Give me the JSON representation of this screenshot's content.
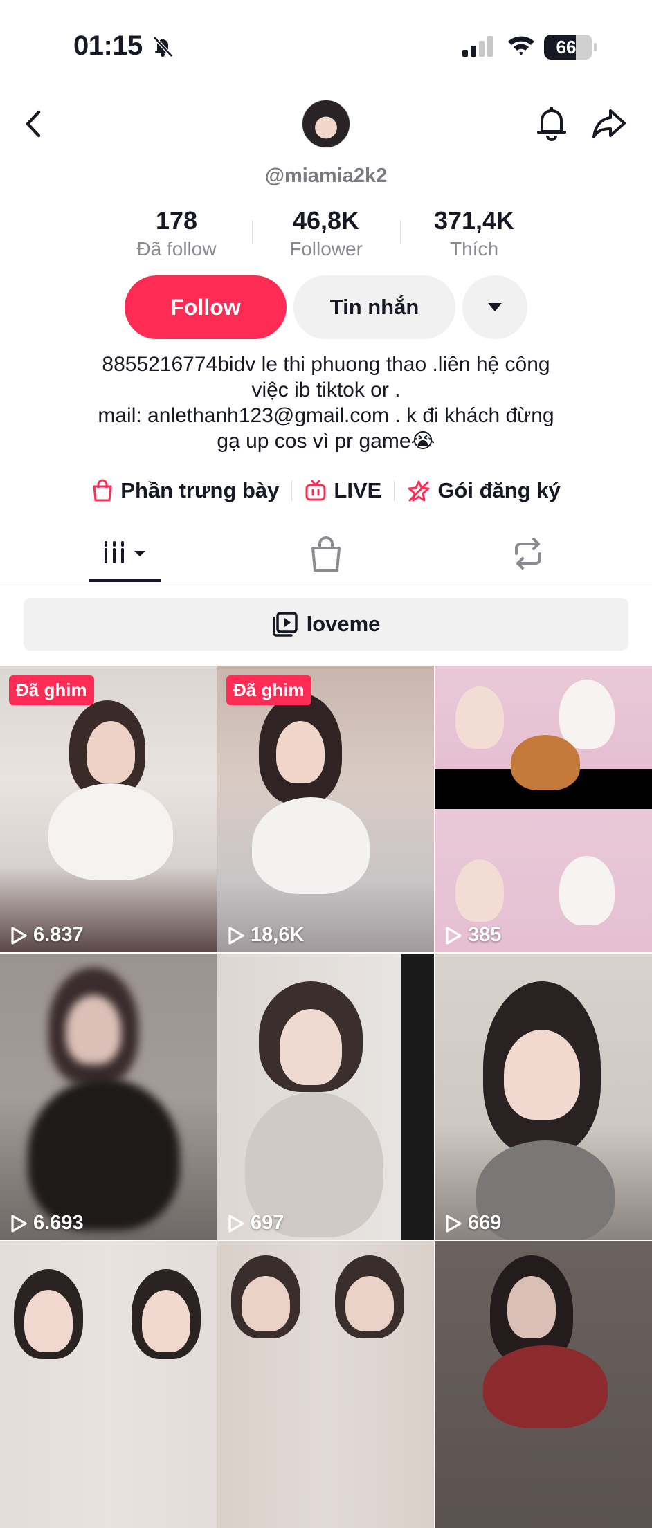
{
  "status_bar": {
    "time": "01:15",
    "battery": "66"
  },
  "profile": {
    "handle": "@miamia2k2",
    "stats": [
      {
        "value": "178",
        "label": "Đã follow"
      },
      {
        "value": "46,8K",
        "label": "Follower"
      },
      {
        "value": "371,4K",
        "label": "Thích"
      }
    ],
    "follow_label": "Follow",
    "message_label": "Tin nhắn",
    "bio": "8855216774bidv le thi phuong thao .liên hệ công\nviệc ib tiktok or .\nmail: anlethanh123@gmail.com  . k đi khách đừng\ngạ up cos vì pr game😭"
  },
  "links": [
    {
      "label": "Phần trưng bày",
      "icon": "shopping-bag-icon"
    },
    {
      "label": "LIVE",
      "icon": "live-tv-icon"
    },
    {
      "label": "Gói đăng ký",
      "icon": "subscription-star-icon"
    }
  ],
  "tabs": [
    "videos-grid-icon",
    "shop-bag-icon",
    "repost-icon"
  ],
  "playlist": {
    "label": "loveme"
  },
  "videos": [
    {
      "views": "6.837",
      "pinned": "Đã ghim"
    },
    {
      "views": "18,6K",
      "pinned": "Đã ghim"
    },
    {
      "views": "385",
      "pinned": ""
    },
    {
      "views": "6.693",
      "pinned": ""
    },
    {
      "views": "697",
      "pinned": ""
    },
    {
      "views": "669",
      "pinned": ""
    },
    {
      "views": "",
      "pinned": ""
    },
    {
      "views": "",
      "pinned": ""
    },
    {
      "views": "",
      "pinned": ""
    }
  ],
  "colors": {
    "accent": "#fe2c55",
    "text": "#161823",
    "muted": "#8a8b91",
    "button_gray": "#f1f1f2"
  }
}
